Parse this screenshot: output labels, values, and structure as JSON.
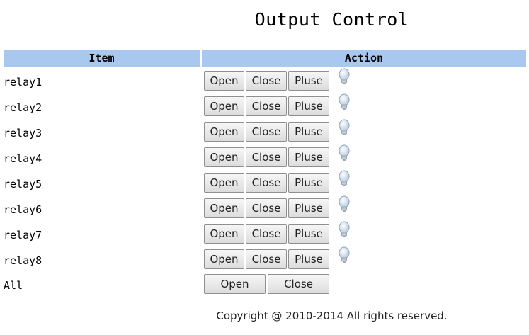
{
  "page": {
    "title": "Output Control",
    "footer": "Copyright @ 2010-2014 All rights reserved."
  },
  "table": {
    "headers": {
      "item": "Item",
      "action": "Action"
    },
    "rows": [
      {
        "label": "relay1",
        "open": "Open",
        "close": "Close",
        "pluse": "Pluse",
        "icon": "lightbulb-icon"
      },
      {
        "label": "relay2",
        "open": "Open",
        "close": "Close",
        "pluse": "Pluse",
        "icon": "lightbulb-icon"
      },
      {
        "label": "relay3",
        "open": "Open",
        "close": "Close",
        "pluse": "Pluse",
        "icon": "lightbulb-icon"
      },
      {
        "label": "relay4",
        "open": "Open",
        "close": "Close",
        "pluse": "Pluse",
        "icon": "lightbulb-icon"
      },
      {
        "label": "relay5",
        "open": "Open",
        "close": "Close",
        "pluse": "Pluse",
        "icon": "lightbulb-icon"
      },
      {
        "label": "relay6",
        "open": "Open",
        "close": "Close",
        "pluse": "Pluse",
        "icon": "lightbulb-icon"
      },
      {
        "label": "relay7",
        "open": "Open",
        "close": "Close",
        "pluse": "Pluse",
        "icon": "lightbulb-icon"
      },
      {
        "label": "relay8",
        "open": "Open",
        "close": "Close",
        "pluse": "Pluse",
        "icon": "lightbulb-icon"
      }
    ],
    "all": {
      "label": "All",
      "open": "Open",
      "close": "Close"
    }
  },
  "colors": {
    "header_bg": "#a8c8f0",
    "button_border": "#8f8f8f"
  }
}
